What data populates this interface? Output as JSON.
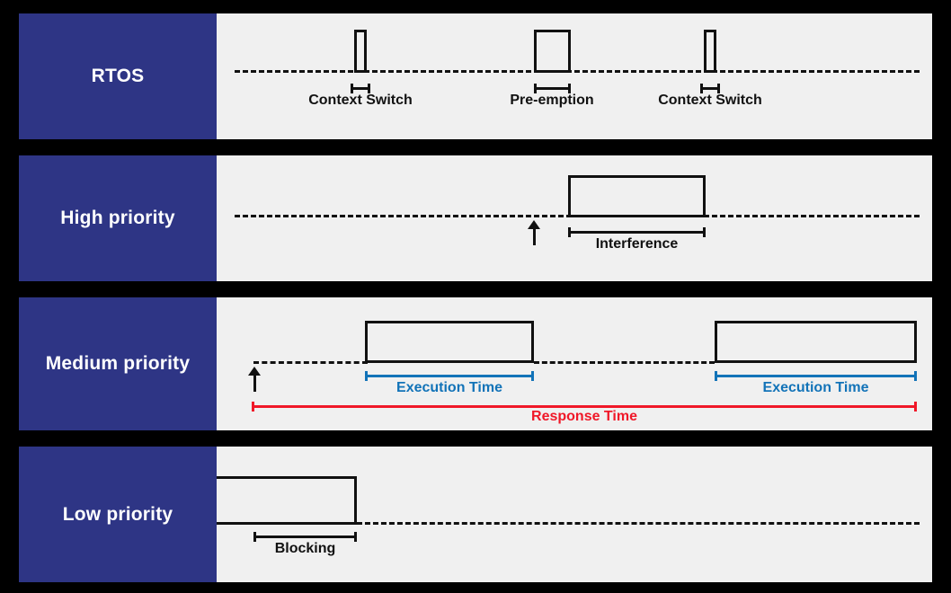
{
  "diagram": {
    "title": "RTOS task scheduling timing diagram",
    "colors": {
      "label_panel": "#2e3585",
      "canvas": "#f0f0f0",
      "background": "#000000",
      "line": "#111111",
      "execution": "#1273b8",
      "response": "#f01828"
    },
    "rows": [
      {
        "key": "rtos",
        "label": "RTOS",
        "annotations": [
          {
            "key": "context-switch-1",
            "label": "Context Switch"
          },
          {
            "key": "pre-emption",
            "label": "Pre-emption"
          },
          {
            "key": "context-switch-2",
            "label": "Context Switch"
          }
        ]
      },
      {
        "key": "high",
        "label": "High priority",
        "annotations": [
          {
            "key": "interference",
            "label": "Interference"
          }
        ]
      },
      {
        "key": "medium",
        "label": "Medium priority",
        "annotations": [
          {
            "key": "execution-time-1",
            "label": "Execution Time"
          },
          {
            "key": "execution-time-2",
            "label": "Execution Time"
          },
          {
            "key": "response-time",
            "label": "Response  Time"
          }
        ]
      },
      {
        "key": "low",
        "label": "Low priority",
        "annotations": [
          {
            "key": "blocking",
            "label": "Blocking"
          }
        ]
      }
    ]
  }
}
